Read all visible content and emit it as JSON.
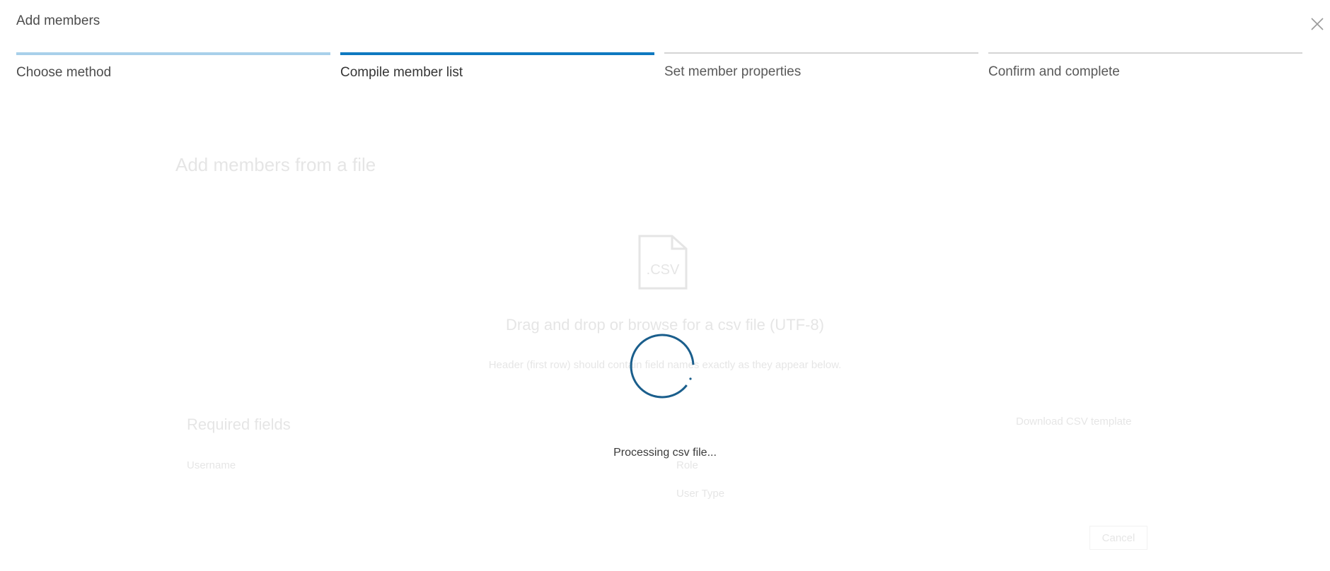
{
  "dialog": {
    "title": "Add members",
    "close_icon": "close-icon"
  },
  "steps": [
    {
      "label": "Choose method",
      "state": "done"
    },
    {
      "label": "Compile member list",
      "state": "active"
    },
    {
      "label": "Set member properties",
      "state": "todo"
    },
    {
      "label": "Confirm and complete",
      "state": "todo"
    }
  ],
  "background": {
    "heading": "Add members from a file",
    "drop_title": "Drag and drop or browse for a csv file (UTF-8)",
    "drop_hint": "Header (first row) should contain field names exactly as they appear below.",
    "required_heading": "Required fields",
    "download_link": "Download CSV template",
    "fields": [
      "Username",
      "Role",
      "User Type"
    ],
    "cancel_label": "Cancel",
    "csv_icon_text": ".CSV"
  },
  "overlay": {
    "status_text": "Processing csv file..."
  },
  "colors": {
    "accent": "#0f79c0",
    "step_done": "#a8d0ea",
    "spinner": "#1a5e8c"
  }
}
